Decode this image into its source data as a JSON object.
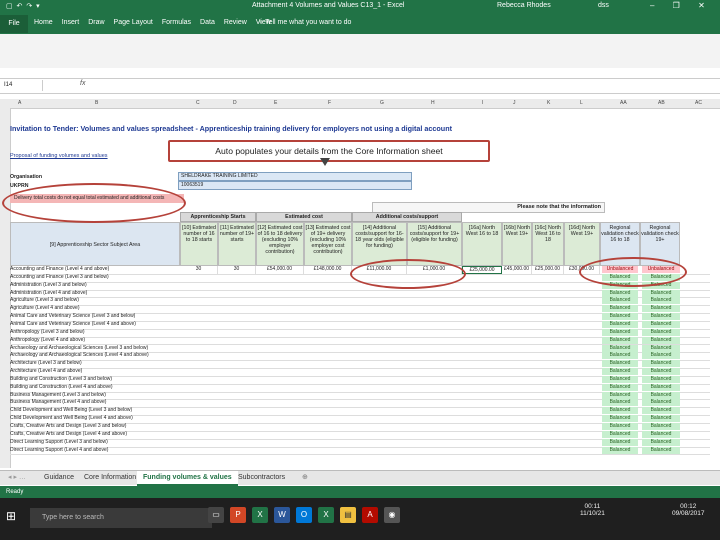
{
  "titlebar": {
    "quick_access": "▢ ↶ ↷ ▾",
    "document_title": "Attachment 4 Volumes and Values C13_1  -  Excel",
    "user": "Rebecca Rhodes",
    "account_abbr": "dss",
    "window_controls": "– ❐ ✕"
  },
  "ribbon": {
    "file_tab": "File",
    "tabs": [
      "Home",
      "Insert",
      "Draw",
      "Page Layout",
      "Formulas",
      "Data",
      "Review",
      "View"
    ],
    "tell_me": "♀ Tell me what you want to do"
  },
  "formula_bar": {
    "name_box": "I14",
    "fx": "fx"
  },
  "columns": [
    "A",
    "B",
    "C",
    "D",
    "E",
    "F",
    "G",
    "H",
    "I",
    "J",
    "K",
    "L",
    "AA",
    "AB",
    "AC"
  ],
  "sheet": {
    "title": "Invitation to Tender: Volumes and values spreadsheet - Apprenticeship training delivery for employers not using a digital account",
    "subtitle": "Proposal of funding volumes and values",
    "org_label": "Organisation",
    "org_value": "SHELDRAKE TRAINING LIMITED",
    "ukprn_label": "UKPRN",
    "ukprn_value": "10063519",
    "warning": "Delivery total costs do not equal total estimated and additional costs",
    "note": "Please note that the information",
    "groups": {
      "starts": "Apprenticeship Starts",
      "estimated": "Estimated cost",
      "additional": "Additional costs/support"
    },
    "col_headers": {
      "area": "[9] Apprenticeship Sector Subject Area",
      "c10": "[10] Estimated number of 16 to 18 starts",
      "c11": "[11] Estimated number of 19+ starts",
      "c12": "[12] Estimated cost of 16 to 18 delivery (excluding 10% employer contribution)",
      "c13": "[13] Estimated cost of 19+ delivery (excluding 10% employer cost contribution)",
      "c14": "[14] Additional costs/support for 16-18 year olds (eligible for funding)",
      "c15": "[15] Additional costs/support for 19+ (eligible for funding)",
      "c16a": "[16a] North West 16 to 18",
      "c16b": "[16b] North West 19+",
      "c16c": "[16c] North West 16 to 18",
      "c16d": "[16d] North West 19+",
      "r1": "Regional validation check 16 to 18",
      "r2": "Regional validation check 19+"
    },
    "first_row": {
      "c10": "30",
      "c11": "30",
      "c12": "£54,000.00",
      "c13": "£148,000.00",
      "c14": "£11,000.00",
      "c15": "£1,000.00",
      "c16a": "£25,000.00",
      "c16b": "£45,000.00",
      "c16c": "£25,000.00",
      "c16d": "£30,000.00",
      "r1": "Unbalanced",
      "r2": "Unbalanced"
    },
    "rows": [
      "Accounting and Finance (Level 4 and above)",
      "Accounting and Finance (Level 3 and below)",
      "Administration (Level 3 and below)",
      "Administration (Level 4 and above)",
      "Agriculture (Level 3 and below)",
      "Agriculture (Level 4 and above)",
      "Animal Care and Veterinary Science (Level 3 and below)",
      "Animal Care and Veterinary Science (Level 4 and above)",
      "Anthropology (Level 3 and below)",
      "Anthropology (Level 4 and above)",
      "Archaeology and Archaeological Sciences (Level 3 and below)",
      "Archaeology and Archaeological Sciences (Level 4 and above)",
      "Architecture (Level 3 and below)",
      "Architecture (Level 4 and above)",
      "Building and Construction (Level 3 and below)",
      "Building and Construction (Level 4 and above)",
      "Business Management (Level 3 and below)",
      "Business Management (Level 4 and above)",
      "Child Development and Well Being (Level 3 and below)",
      "Child Development and Well Being (Level 4 and above)",
      "Crafts, Creative Arts and Design (Level 3 and below)",
      "Crafts, Creative Arts and Design (Level 4 and above)",
      "Direct Learning Support (Level 3 and below)",
      "Direct Learning Support (Level 4 and above)"
    ],
    "balanced_label": "Balanced"
  },
  "callout": "Auto populates your details from the Core Information sheet",
  "sheet_tabs": [
    "Guidance",
    "Core Information",
    "Funding volumes & values",
    "Subcontractors"
  ],
  "status": {
    "ready": "Ready"
  },
  "taskbar": {
    "search": "Type here to search",
    "time1": "00:11",
    "date1": "11/10/21",
    "time2": "00:12",
    "date2": "09/08/2017"
  },
  "colors": {
    "excel_green": "#217346",
    "callout_red": "#b5423a",
    "balanced_bg": "#c6efce",
    "unbalanced_bg": "#ffc7ce"
  }
}
